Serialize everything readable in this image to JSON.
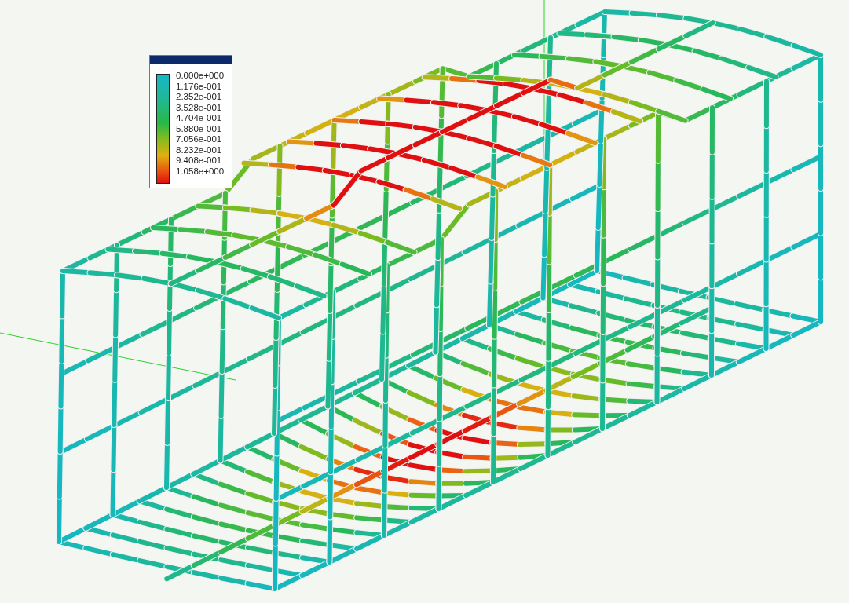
{
  "legend": {
    "labels": [
      "0.000e+000",
      "1.176e-001",
      "2.352e-001",
      "3.528e-001",
      "4.704e-001",
      "5.880e-001",
      "7.056e-001",
      "8.232e-001",
      "9.408e-001",
      "1.058e+000"
    ]
  }
}
